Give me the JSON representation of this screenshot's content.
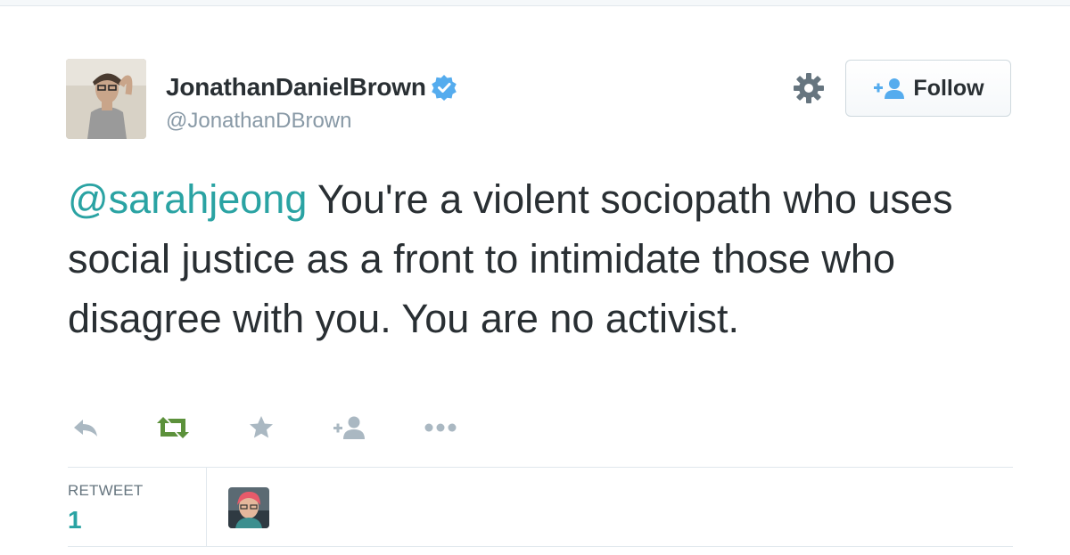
{
  "author": {
    "display_name": "JonathanDanielBrown",
    "screen_name": "@JonathanDBrown",
    "verified": true
  },
  "header_actions": {
    "follow_label": "Follow"
  },
  "tweet": {
    "mention": "@sarahjeong",
    "body": " You're a violent sociopath who uses social justice as a front to intimidate those who disagree with you. You are no activist."
  },
  "tweet_actions": [
    "reply-icon",
    "retweet-icon",
    "favorite-icon",
    "follow-icon",
    "more-icon"
  ],
  "stats": {
    "retweet_label": "RETWEET",
    "retweet_count": "1"
  },
  "colors": {
    "mention": "#2aa3a3",
    "verified": "#55acee",
    "retweet_active": "#5c913b",
    "muted_icon": "#aab8c2"
  }
}
